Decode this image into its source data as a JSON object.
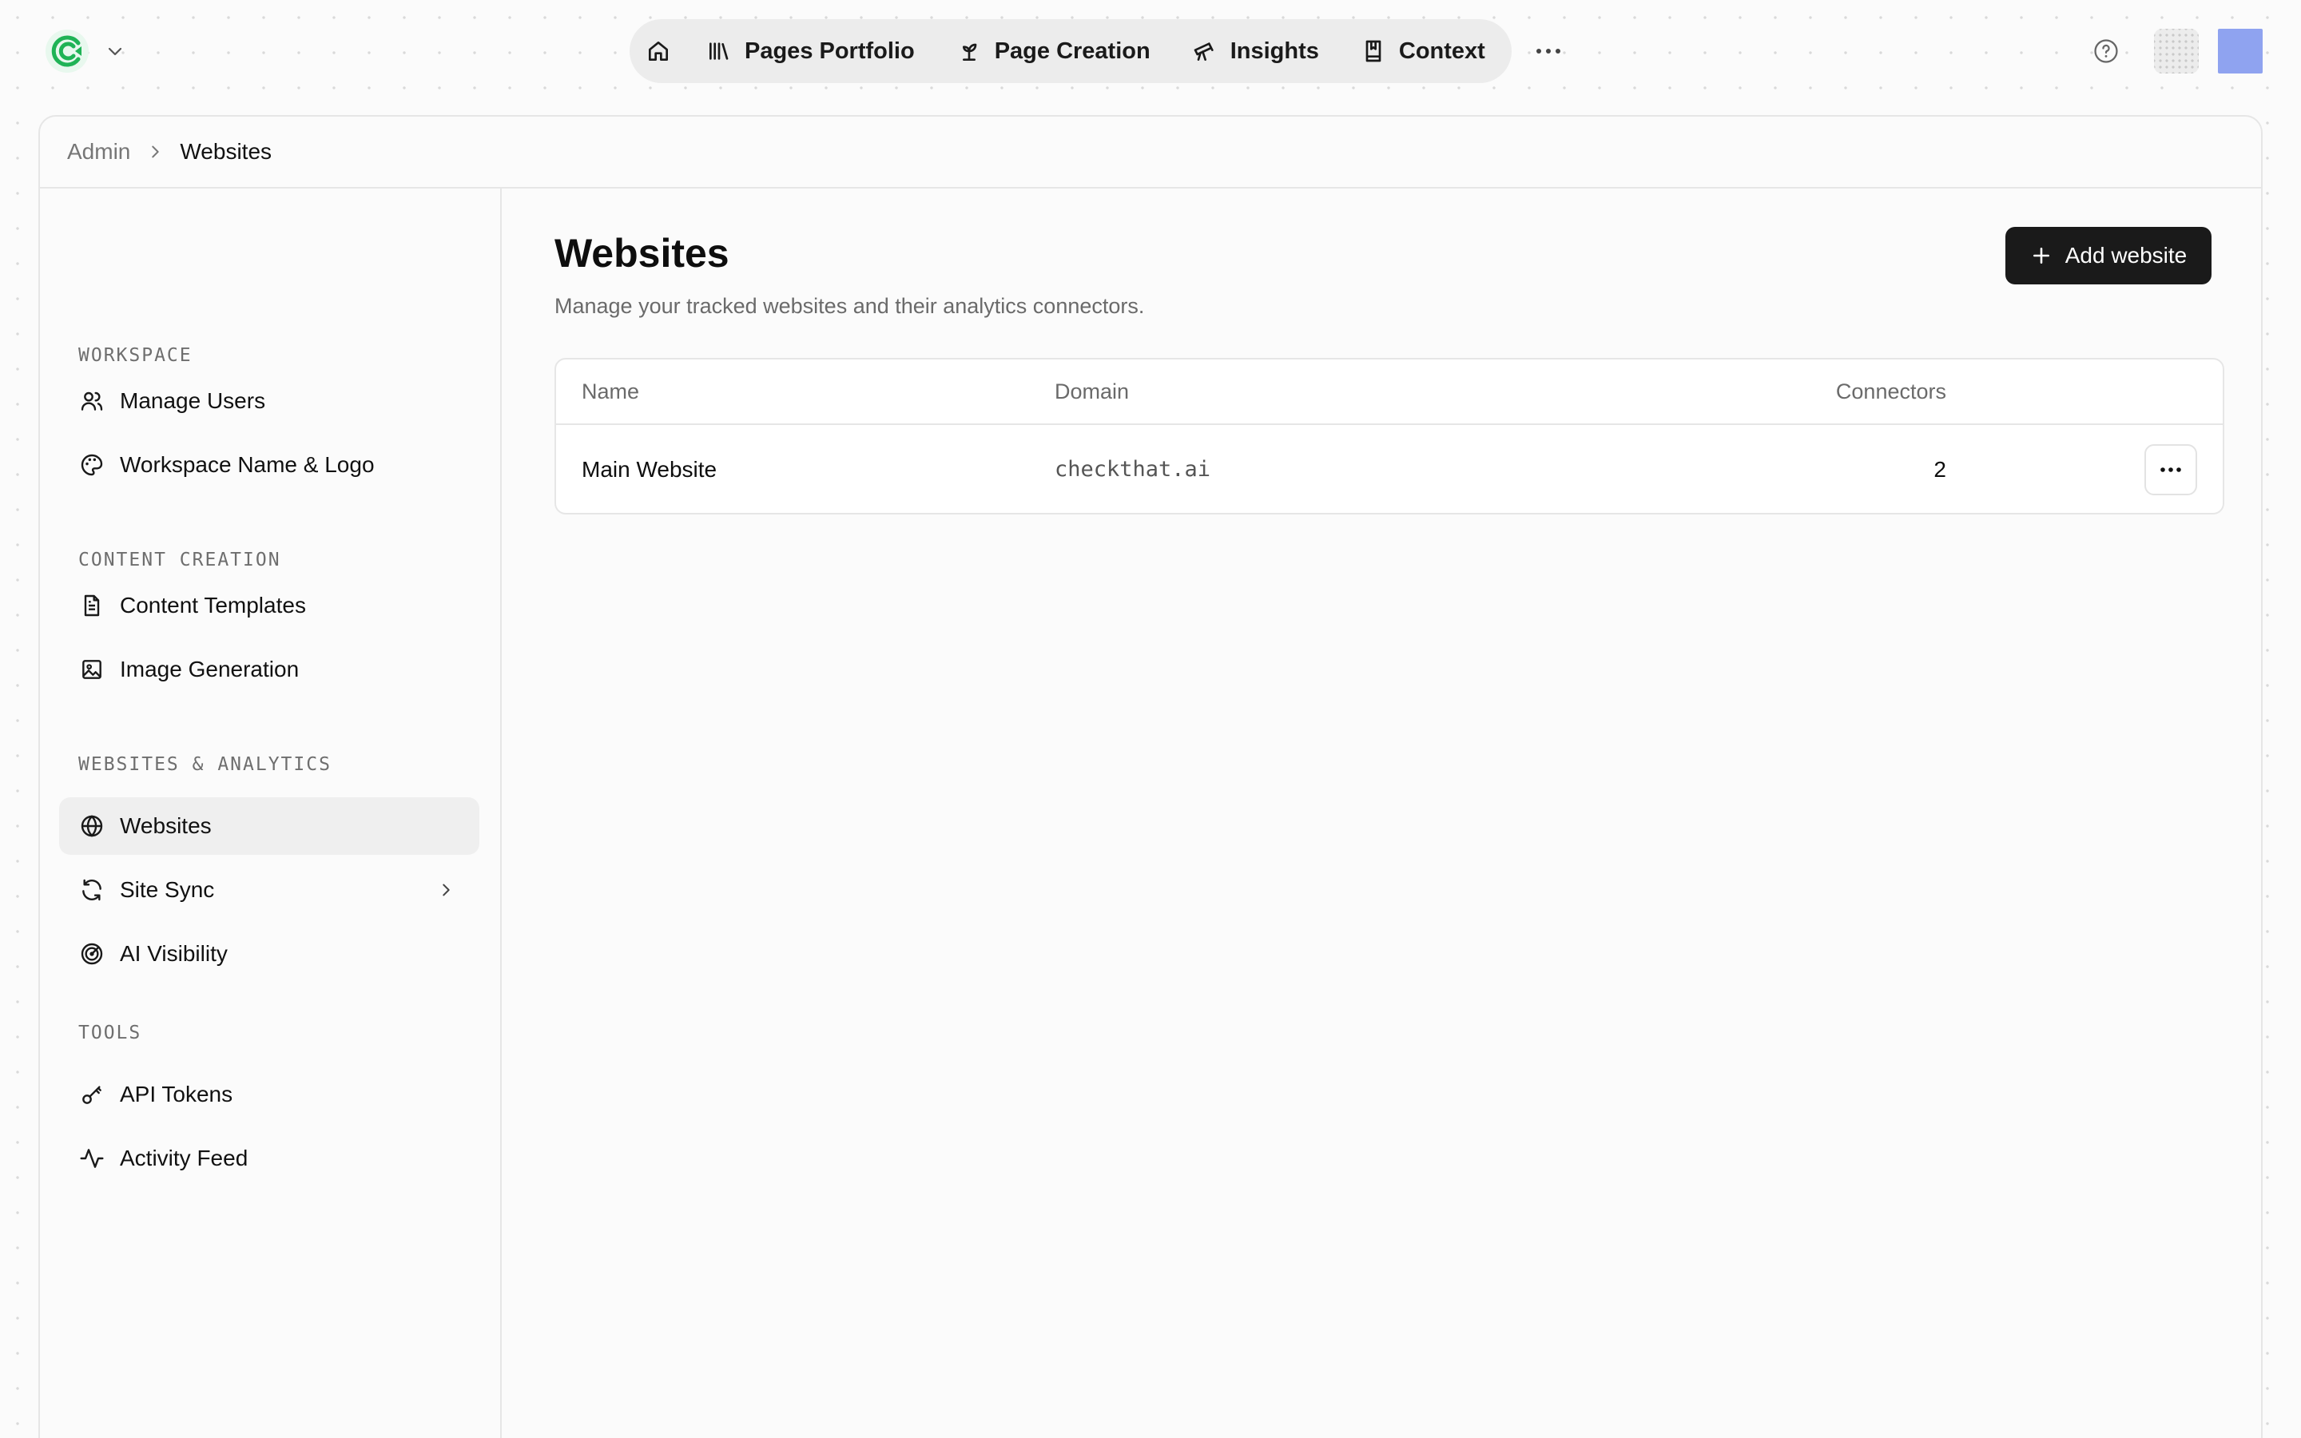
{
  "app": {
    "logo": "checkthat-logo",
    "accent": "#1fb356"
  },
  "topnav": {
    "home_icon": "home-icon",
    "items": [
      {
        "label": "Pages Portfolio",
        "icon": "library-icon"
      },
      {
        "label": "Page Creation",
        "icon": "sprout-icon"
      },
      {
        "label": "Insights",
        "icon": "telescope-icon"
      },
      {
        "label": "Context",
        "icon": "book-icon"
      }
    ],
    "more_icon": "more-horizontal-icon"
  },
  "header_right": {
    "help_icon": "help-circle-icon",
    "apps_icon": "grid-icon",
    "avatar_color": "#8fa3f0"
  },
  "breadcrumb": {
    "items": [
      "Admin",
      "Websites"
    ]
  },
  "sidebar": {
    "sections": [
      {
        "title": "WORKSPACE",
        "items": [
          {
            "label": "Manage Users",
            "icon": "users-icon"
          },
          {
            "label": "Workspace Name & Logo",
            "icon": "palette-icon"
          }
        ]
      },
      {
        "title": "CONTENT CREATION",
        "items": [
          {
            "label": "Content Templates",
            "icon": "file-text-icon"
          },
          {
            "label": "Image Generation",
            "icon": "image-icon"
          }
        ]
      },
      {
        "title": "WEBSITES & ANALYTICS",
        "items": [
          {
            "label": "Websites",
            "icon": "globe-icon",
            "active": true
          },
          {
            "label": "Site Sync",
            "icon": "refresh-icon",
            "has_submenu": true
          },
          {
            "label": "AI Visibility",
            "icon": "radar-icon"
          }
        ]
      },
      {
        "title": "TOOLS",
        "items": [
          {
            "label": "API Tokens",
            "icon": "key-icon"
          },
          {
            "label": "Activity Feed",
            "icon": "activity-icon"
          }
        ]
      }
    ]
  },
  "main": {
    "title": "Websites",
    "subtitle": "Manage your tracked websites and their analytics connectors.",
    "add_button": {
      "label": "Add website",
      "icon": "plus-icon"
    },
    "table": {
      "columns": [
        "Name",
        "Domain",
        "Connectors"
      ],
      "rows": [
        {
          "name": "Main Website",
          "domain": "checkthat.ai",
          "connectors": "2"
        }
      ]
    }
  }
}
